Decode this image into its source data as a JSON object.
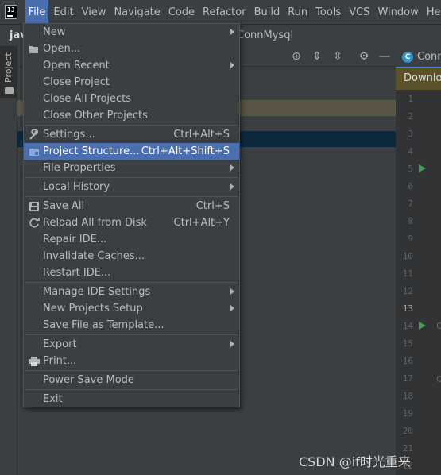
{
  "menubar": {
    "items": [
      "File",
      "Edit",
      "View",
      "Navigate",
      "Code",
      "Refactor",
      "Build",
      "Run",
      "Tools",
      "VCS",
      "Window",
      "Help"
    ]
  },
  "breadcrumb": {
    "project": "jav",
    "file": "ConnMysql"
  },
  "sidebar": {
    "project_tab": "Project"
  },
  "editor": {
    "tab_label": "Conn",
    "class_badge": "C",
    "banner": "Downloa",
    "line_numbers": [
      "1",
      "2",
      "3",
      "4",
      "5",
      "6",
      "7",
      "8",
      "9",
      "10",
      "11",
      "12",
      "13",
      "14",
      "15",
      "16",
      "17",
      "18",
      "19",
      "20",
      "21",
      "22"
    ],
    "current_line": "13"
  },
  "file_menu": {
    "items": [
      {
        "label": "New",
        "submenu": true
      },
      {
        "label": "Open...",
        "icon": "folder-open-icon"
      },
      {
        "label": "Open Recent",
        "submenu": true
      },
      {
        "label": "Close Project"
      },
      {
        "label": "Close All Projects"
      },
      {
        "label": "Close Other Projects"
      },
      {
        "label": "Settings...",
        "shortcut": "Ctrl+Alt+S",
        "icon": "wrench-icon"
      },
      {
        "label": "Project Structure...",
        "shortcut": "Ctrl+Alt+Shift+S",
        "icon": "project-structure-icon",
        "highlighted": true
      },
      {
        "label": "File Properties",
        "submenu": true
      },
      {
        "label": "Local History",
        "submenu": true
      },
      {
        "label": "Save All",
        "shortcut": "Ctrl+S",
        "icon": "save-icon"
      },
      {
        "label": "Reload All from Disk",
        "shortcut": "Ctrl+Alt+Y",
        "icon": "reload-icon"
      },
      {
        "label": "Repair IDE..."
      },
      {
        "label": "Invalidate Caches..."
      },
      {
        "label": "Restart IDE..."
      },
      {
        "label": "Manage IDE Settings",
        "submenu": true
      },
      {
        "label": "New Projects Setup",
        "submenu": true
      },
      {
        "label": "Save File as Template..."
      },
      {
        "label": "Export",
        "submenu": true
      },
      {
        "label": "Print...",
        "icon": "print-icon"
      },
      {
        "label": "Power Save Mode"
      },
      {
        "label": "Exit"
      }
    ]
  },
  "watermark": "CSDN @if时光重来",
  "colors": {
    "menu_bg": "#3c3f41",
    "highlight": "#4b6eaf",
    "editor_bg": "#2b2b2b",
    "run_marker": "#499c54"
  }
}
